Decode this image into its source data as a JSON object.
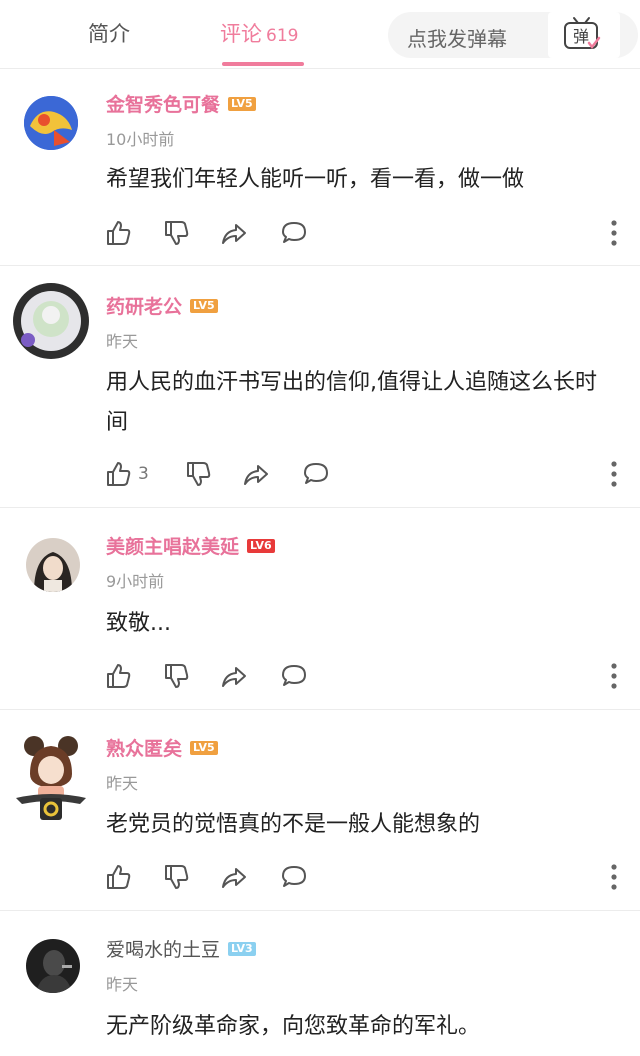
{
  "tabs": {
    "intro_label": "简介",
    "comments_label": "评论",
    "comments_count": "619"
  },
  "danmaku": {
    "placeholder": "点我发弹幕",
    "toggle_label": "弹"
  },
  "colors": {
    "accent": "#f07c9c",
    "username": "#e8729a",
    "level_orange": "#f0a040",
    "level_red": "#e83a3a",
    "level_blue": "#8bd0f0"
  },
  "comments": [
    {
      "username": "金智秀色可餐",
      "level": "LV5",
      "time": "10小时前",
      "text": "希望我们年轻人能听一听，看一看，做一做",
      "likes": ""
    },
    {
      "username": "药研老公",
      "level": "LV5",
      "time": "昨天",
      "text": "用人民的血汗书写出的信仰,值得让人追随这么长时间",
      "likes": "3"
    },
    {
      "username": "美颜主唱赵美延",
      "level": "LV6",
      "time": "9小时前",
      "text": "致敬...",
      "likes": ""
    },
    {
      "username": "熟众匿矣",
      "level": "LV5",
      "time": "昨天",
      "text": "老党员的觉悟真的不是一般人能想象的",
      "likes": ""
    },
    {
      "username": "爱喝水的土豆",
      "level": "LV3",
      "time": "昨天",
      "text": "无产阶级革命家，向您致革命的军礼。",
      "likes": ""
    }
  ]
}
